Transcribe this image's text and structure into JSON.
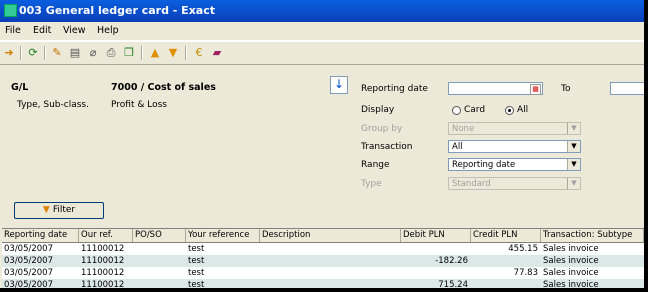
{
  "window": {
    "title": "003 General ledger card - Exact"
  },
  "menu": [
    "File",
    "Edit",
    "View",
    "Help"
  ],
  "toolbar": {
    "icons": [
      "open-icon",
      "refresh-icon",
      "edit-icon",
      "document-icon",
      "attach-icon",
      "print-icon",
      "copy-icon",
      "up-arrow-icon",
      "down-arrow-icon",
      "currency-icon",
      "book-icon"
    ]
  },
  "header": {
    "gl_label": "G/L",
    "gl_value": "7000 / Cost of sales",
    "type_label": "Type, Sub-class.",
    "type_value": "Profit & Loss"
  },
  "form": {
    "reporting_date_label": "Reporting date",
    "to_label": "To",
    "display_label": "Display",
    "display_card": "Card",
    "display_all": "All",
    "group_by_label": "Group by",
    "group_by_value": "None",
    "transaction_label": "Transaction",
    "transaction_value": "All",
    "range_label": "Range",
    "range_value": "Reporting date",
    "type_label": "Type",
    "type_value": "Standard"
  },
  "filter_button": "Filter",
  "table": {
    "columns": [
      "Reporting date",
      "Our ref.",
      "PO/SO",
      "Your reference",
      "Description",
      "Debit PLN",
      "Credit PLN",
      "Transaction: Subtype"
    ],
    "rows": [
      [
        "03/05/2007",
        "11100012",
        "",
        "test",
        "",
        "",
        "455.15",
        "Sales invoice"
      ],
      [
        "03/05/2007",
        "11100012",
        "",
        "test",
        "",
        "-182.26",
        "",
        "Sales invoice"
      ],
      [
        "03/05/2007",
        "11100012",
        "",
        "test",
        "",
        "",
        "77.83",
        "Sales invoice"
      ],
      [
        "03/05/2007",
        "11100012",
        "",
        "test",
        "",
        "715.24",
        "",
        "Sales invoice"
      ]
    ]
  }
}
